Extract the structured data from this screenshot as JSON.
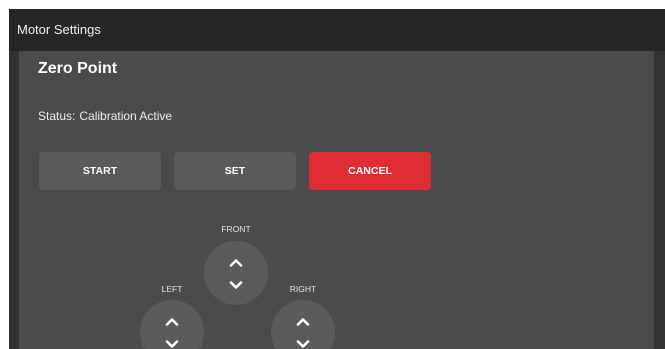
{
  "window": {
    "title": "Motor Settings"
  },
  "section": {
    "title": "Zero Point"
  },
  "status": {
    "label": "Status:",
    "value": "Calibration Active"
  },
  "buttons": {
    "start": "START",
    "set": "SET",
    "cancel": "CANCEL"
  },
  "direction_pad": {
    "front": "FRONT",
    "left": "LEFT",
    "right": "RIGHT"
  },
  "colors": {
    "title_bar": "#262626",
    "panel": "#4b4b4b",
    "button": "#5a5a5a",
    "cancel": "#e02d34",
    "pad": "#5b5b5b"
  },
  "icons": {
    "up": "chevron-up-icon",
    "down": "chevron-down-icon"
  }
}
